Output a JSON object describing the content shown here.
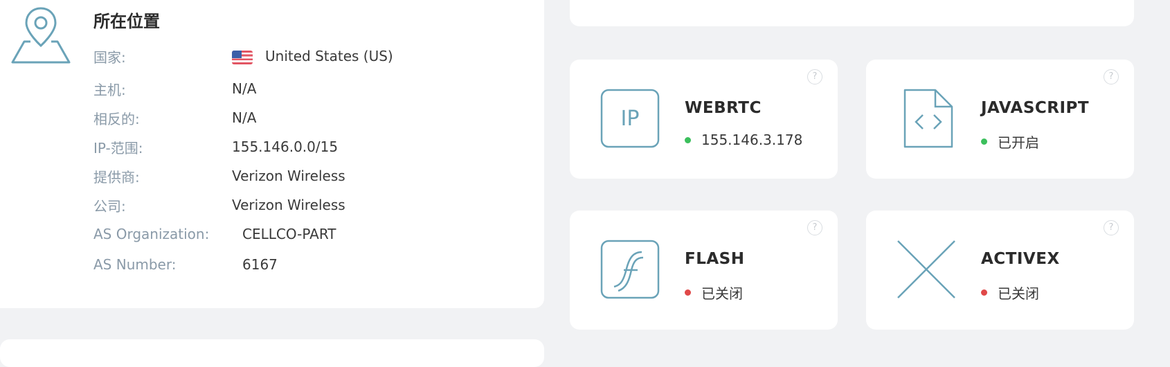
{
  "location": {
    "title": "所在位置",
    "icon": "map-pin-icon",
    "rows": [
      {
        "label": "国家:",
        "value": "United States (US)",
        "flag": "us-flag-icon"
      },
      {
        "label": "主机:",
        "value": "N/A"
      },
      {
        "label": "相反的:",
        "value": "N/A"
      },
      {
        "label": "IP-范围:",
        "value": "155.146.0.0/15"
      },
      {
        "label": "提供商:",
        "value": "Verizon Wireless"
      },
      {
        "label": "公司:",
        "value": "Verizon Wireless"
      },
      {
        "label": "AS Organization:",
        "value": "CELLCO-PART"
      },
      {
        "label": "AS Number:",
        "value": "6167"
      }
    ]
  },
  "features": [
    {
      "name": "WEBRTC",
      "status": "155.146.3.178",
      "state": "on",
      "icon": "ip-box-icon",
      "help": "?"
    },
    {
      "name": "JAVASCRIPT",
      "status": "已开启",
      "state": "on",
      "icon": "code-file-icon",
      "help": "?"
    },
    {
      "name": "FLASH",
      "status": "已关闭",
      "state": "off",
      "icon": "flash-icon",
      "help": "?"
    },
    {
      "name": "ACTIVEX",
      "status": "已关闭",
      "state": "off",
      "icon": "activex-cross-icon",
      "help": "?"
    }
  ],
  "colors": {
    "background": "#f1f2f4",
    "accent_icon": "#6aa3b8",
    "label": "#8a9aa8",
    "status_on": "#3bbf5c",
    "status_off": "#e04848"
  }
}
